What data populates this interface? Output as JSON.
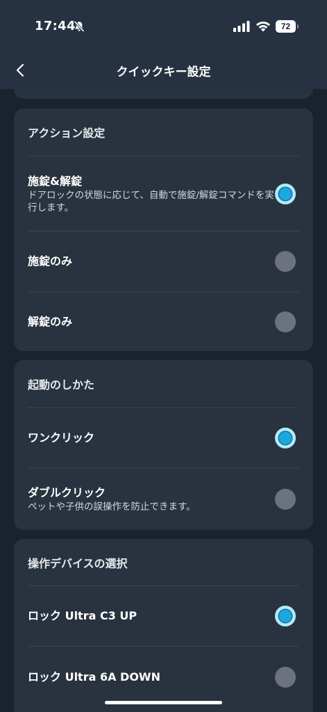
{
  "status_bar": {
    "time": "17:44",
    "battery_level": "72",
    "icons": [
      "bell-slash-icon",
      "cellular-signal-icon",
      "wifi-icon",
      "battery-icon"
    ]
  },
  "header": {
    "title": "クイックキー設定",
    "back_icon": "chevron-left-icon"
  },
  "sections": [
    {
      "title": "アクション設定",
      "options": [
        {
          "label": "施錠&解錠",
          "description": "ドアロックの状態に応じて、自動で施錠/解錠コマンドを実行します。",
          "selected": true
        },
        {
          "label": "施錠のみ",
          "selected": false
        },
        {
          "label": "解錠のみ",
          "selected": false
        }
      ]
    },
    {
      "title": "起動のしかた",
      "options": [
        {
          "label": "ワンクリック",
          "selected": true
        },
        {
          "label": "ダブルクリック",
          "description": "ペットや子供の誤操作を防止できます。",
          "selected": false
        }
      ]
    },
    {
      "title": "操作デバイスの選択",
      "options": [
        {
          "label": "ロック Ultra C3 UP",
          "selected": true
        },
        {
          "label": "ロック Ultra 6A DOWN",
          "selected": false
        }
      ]
    }
  ],
  "colors": {
    "background": "#1a222d",
    "header": "#263141",
    "card": "#29333f",
    "divider": "#3a4350",
    "radio_selected": "#1aa8e0",
    "radio_selected_ring": "#b1ebfb",
    "radio_unselected": "#6c737d",
    "text_primary": "#ffffff",
    "text_secondary": "#d3d7dd"
  }
}
